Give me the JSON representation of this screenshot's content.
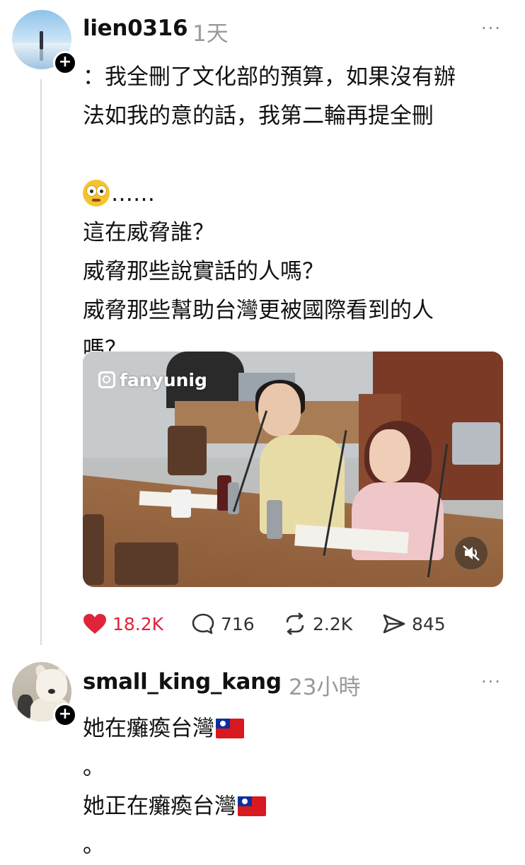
{
  "post1": {
    "username": "lien0316",
    "time": "1天",
    "more": "···",
    "lines": [
      "：我全刪了文化部的預算，如果沒有辦",
      "法如我的意的話，我第二輪再提全刪",
      "",
      "……",
      "這在威脅誰？",
      "威脅那些說實話的人嗎？",
      "威脅那些幫助台灣更被國際看到的人",
      "嗎？"
    ],
    "emoji": "flushed-face-emoji",
    "video": {
      "watermark": "fanyunig",
      "mute_icon": "muted-speaker-icon"
    },
    "actions": {
      "likes": "18.2K",
      "replies": "716",
      "reposts": "2.2K",
      "shares": "845"
    },
    "colors": {
      "like": "#e0243a",
      "thread_line": "#dcdcdc"
    }
  },
  "post2": {
    "username": "small_king_kang",
    "time": "23小時",
    "more": "···",
    "lines": [
      "她在癱瘓台灣",
      "。",
      "她正在癱瘓台灣",
      "。"
    ],
    "flag_icon": "taiwan-flag-emoji"
  }
}
